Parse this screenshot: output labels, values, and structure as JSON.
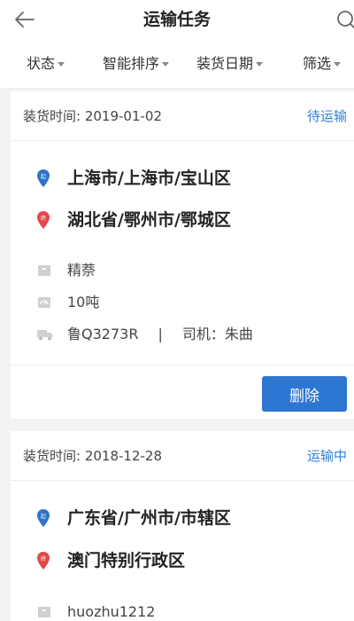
{
  "header": {
    "title": "运输任务"
  },
  "filters": [
    {
      "label": "状态",
      "has_caret": true
    },
    {
      "label": "智能排序",
      "has_caret": true
    },
    {
      "label": "装货日期",
      "has_caret": true
    },
    {
      "label": "筛选",
      "has_caret": true
    }
  ],
  "cards": [
    {
      "load_time": "装货时间: 2019-01-02",
      "status": "待运输",
      "origin": "上海市/上海市/宝山区",
      "origin_pin_label": "起",
      "destination": "湖北省/鄂州市/鄂城区",
      "destination_pin_label": "终",
      "cargo": "精萘",
      "weight": "10吨",
      "plate": "鲁Q3273R",
      "separator": "|",
      "driver": "司机：朱曲",
      "delete_label": "删除"
    },
    {
      "load_time": "装货时间: 2018-12-28",
      "status": "运输中",
      "origin": "广东省/广州市/市辖区",
      "origin_pin_label": "起",
      "destination": "澳门特别行政区",
      "destination_pin_label": "终",
      "cargo": "huozhu1212"
    }
  ],
  "colors": {
    "accent": "#2d76d2",
    "status_text": "#2f7fd6",
    "origin_pin": "#2f72c9",
    "destination_pin": "#e2494b",
    "icon_gray": "#c8c8c8"
  },
  "icons": {
    "back": "arrow-left-icon",
    "search": "search-icon",
    "cargo": "box-icon",
    "weight": "scale-icon",
    "truck": "truck-icon"
  }
}
